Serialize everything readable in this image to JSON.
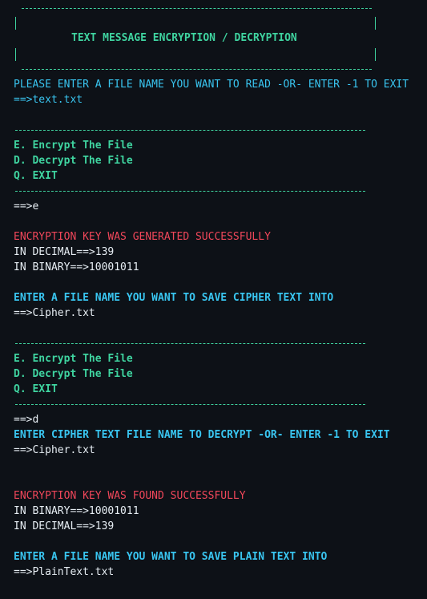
{
  "banner": {
    "title": "TEXT MESSAGE ENCRYPTION / DECRYPTION"
  },
  "prompt_file": {
    "text": "PLEASE ENTER A FILE NAME YOU WANT TO READ -OR- ENTER -1 TO EXIT",
    "input": "==>text.txt"
  },
  "menu1": {
    "encrypt": "E. Encrypt The File",
    "decrypt": "D. Decrypt The File",
    "exit": "Q. EXIT",
    "input": "==>e"
  },
  "encryption": {
    "status": "ENCRYPTION KEY WAS GENERATED SUCCESSFULLY",
    "decimal": "IN DECIMAL==>139",
    "binary": "IN BINARY==>10001011",
    "save_prompt": "ENTER A FILE NAME YOU WANT TO SAVE CIPHER TEXT INTO",
    "save_input": "==>Cipher.txt"
  },
  "menu2": {
    "encrypt": "E. Encrypt The File",
    "decrypt": "D. Decrypt The File",
    "exit": "Q. EXIT",
    "input": "==>d"
  },
  "decryption": {
    "prompt": "ENTER CIPHER TEXT FILE NAME TO DECRYPT -OR- ENTER -1 TO EXIT",
    "input": "==>Cipher.txt",
    "status": "ENCRYPTION KEY WAS FOUND SUCCESSFULLY",
    "binary": "IN BINARY==>10001011",
    "decimal": "IN DECIMAL==>139",
    "save_prompt": "ENTER A FILE NAME YOU WANT TO SAVE PLAIN TEXT INTO",
    "save_input": "==>PlainText.txt"
  }
}
